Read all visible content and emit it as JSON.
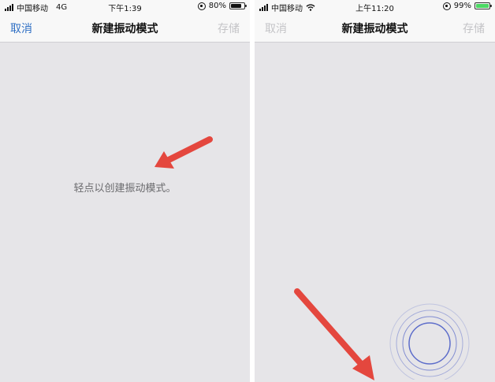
{
  "colors": {
    "accent": "#2f6fc4",
    "disabled": "#c4c4c7",
    "background": "#e6e5e8",
    "bar": "#f8f8f8",
    "annotation_arrow": "#e4473e",
    "ripple": "#5566c8"
  },
  "left_screen": {
    "status": {
      "carrier": "中国移动",
      "network": "4G",
      "time": "下午1:39",
      "battery_percent": "80%",
      "battery_level": 0.8
    },
    "nav": {
      "cancel_label": "取消",
      "title": "新建振动模式",
      "save_label": "存储"
    },
    "hint": "轻点以创建振动模式。"
  },
  "right_screen": {
    "status": {
      "carrier": "中国移动",
      "time": "上午11:20",
      "battery_percent": "99%",
      "battery_level": 0.99
    },
    "nav": {
      "cancel_label": "取消",
      "title": "新建振动模式",
      "save_label": "存储"
    }
  },
  "icons": [
    "signal-icon",
    "wifi-icon",
    "orientation-lock-icon",
    "battery-icon",
    "annotation-arrow-icon",
    "touch-ripple-icon"
  ]
}
